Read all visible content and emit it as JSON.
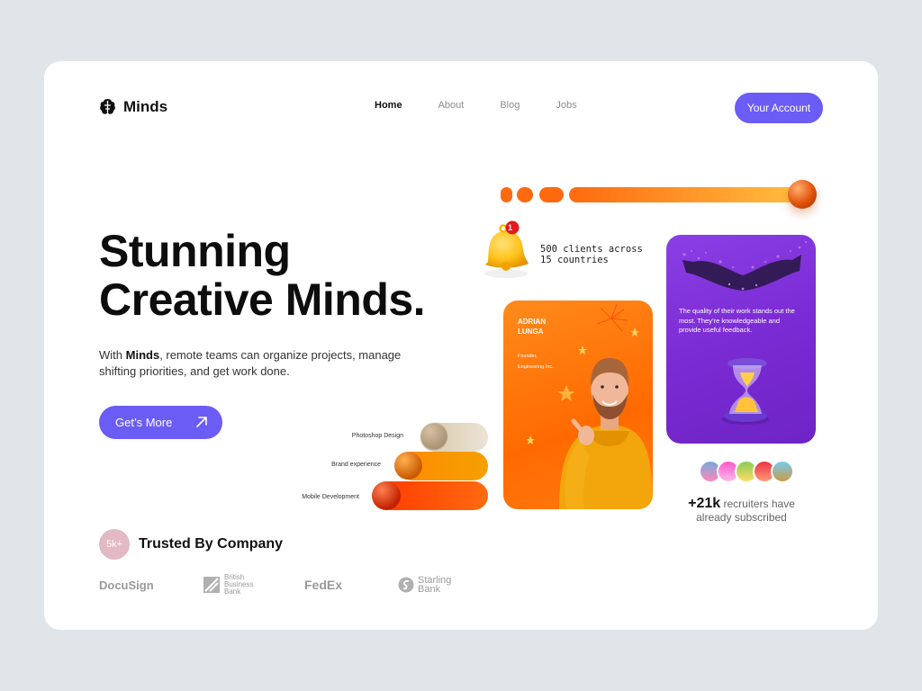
{
  "brand": {
    "name": "Minds"
  },
  "nav": {
    "items": [
      "Home",
      "About",
      "Blog",
      "Jobs"
    ],
    "active": "Home"
  },
  "account_button": "Your Account",
  "hero": {
    "title_line1": "Stunning",
    "title_line2": "Creative Minds.",
    "desc_prefix": "With ",
    "desc_brand": "Minds",
    "desc_suffix": ", remote teams can organize projects, manage shifting priorities, and get work done.",
    "cta": "Get’s More"
  },
  "notification": {
    "count": "1",
    "stat_line1": "500 clients across",
    "stat_line2": "15 countries"
  },
  "skills": [
    {
      "label": "Photoshop Design"
    },
    {
      "label": "Brand experience"
    },
    {
      "label": "Mobile Development"
    }
  ],
  "profile": {
    "name_line1": "ADRIAN",
    "name_line2": "LUNGA",
    "role_line1": "Founder,",
    "role_line2": "Engineering Inc."
  },
  "testimonial": {
    "quote": "The quality of their work stands out the most. They’re knowledgeable and provide useful feedback."
  },
  "recruiters": {
    "count": "+21k",
    "text_line1": " recruiters have",
    "text_line2": "already subscribed"
  },
  "trusted": {
    "badge": "5k+",
    "label": "Trusted By Company"
  },
  "companies": {
    "docusign": "DocuSign",
    "bbb_line1": "British",
    "bbb_line2": "Business",
    "bbb_line3": "Bank",
    "fedex": "FedEx",
    "starling_line1": "Starling",
    "starling_line2": "Bank"
  },
  "colors": {
    "accent": "#6b5cf5",
    "orange": "#ff7a10",
    "purple": "#7b2bd3"
  }
}
